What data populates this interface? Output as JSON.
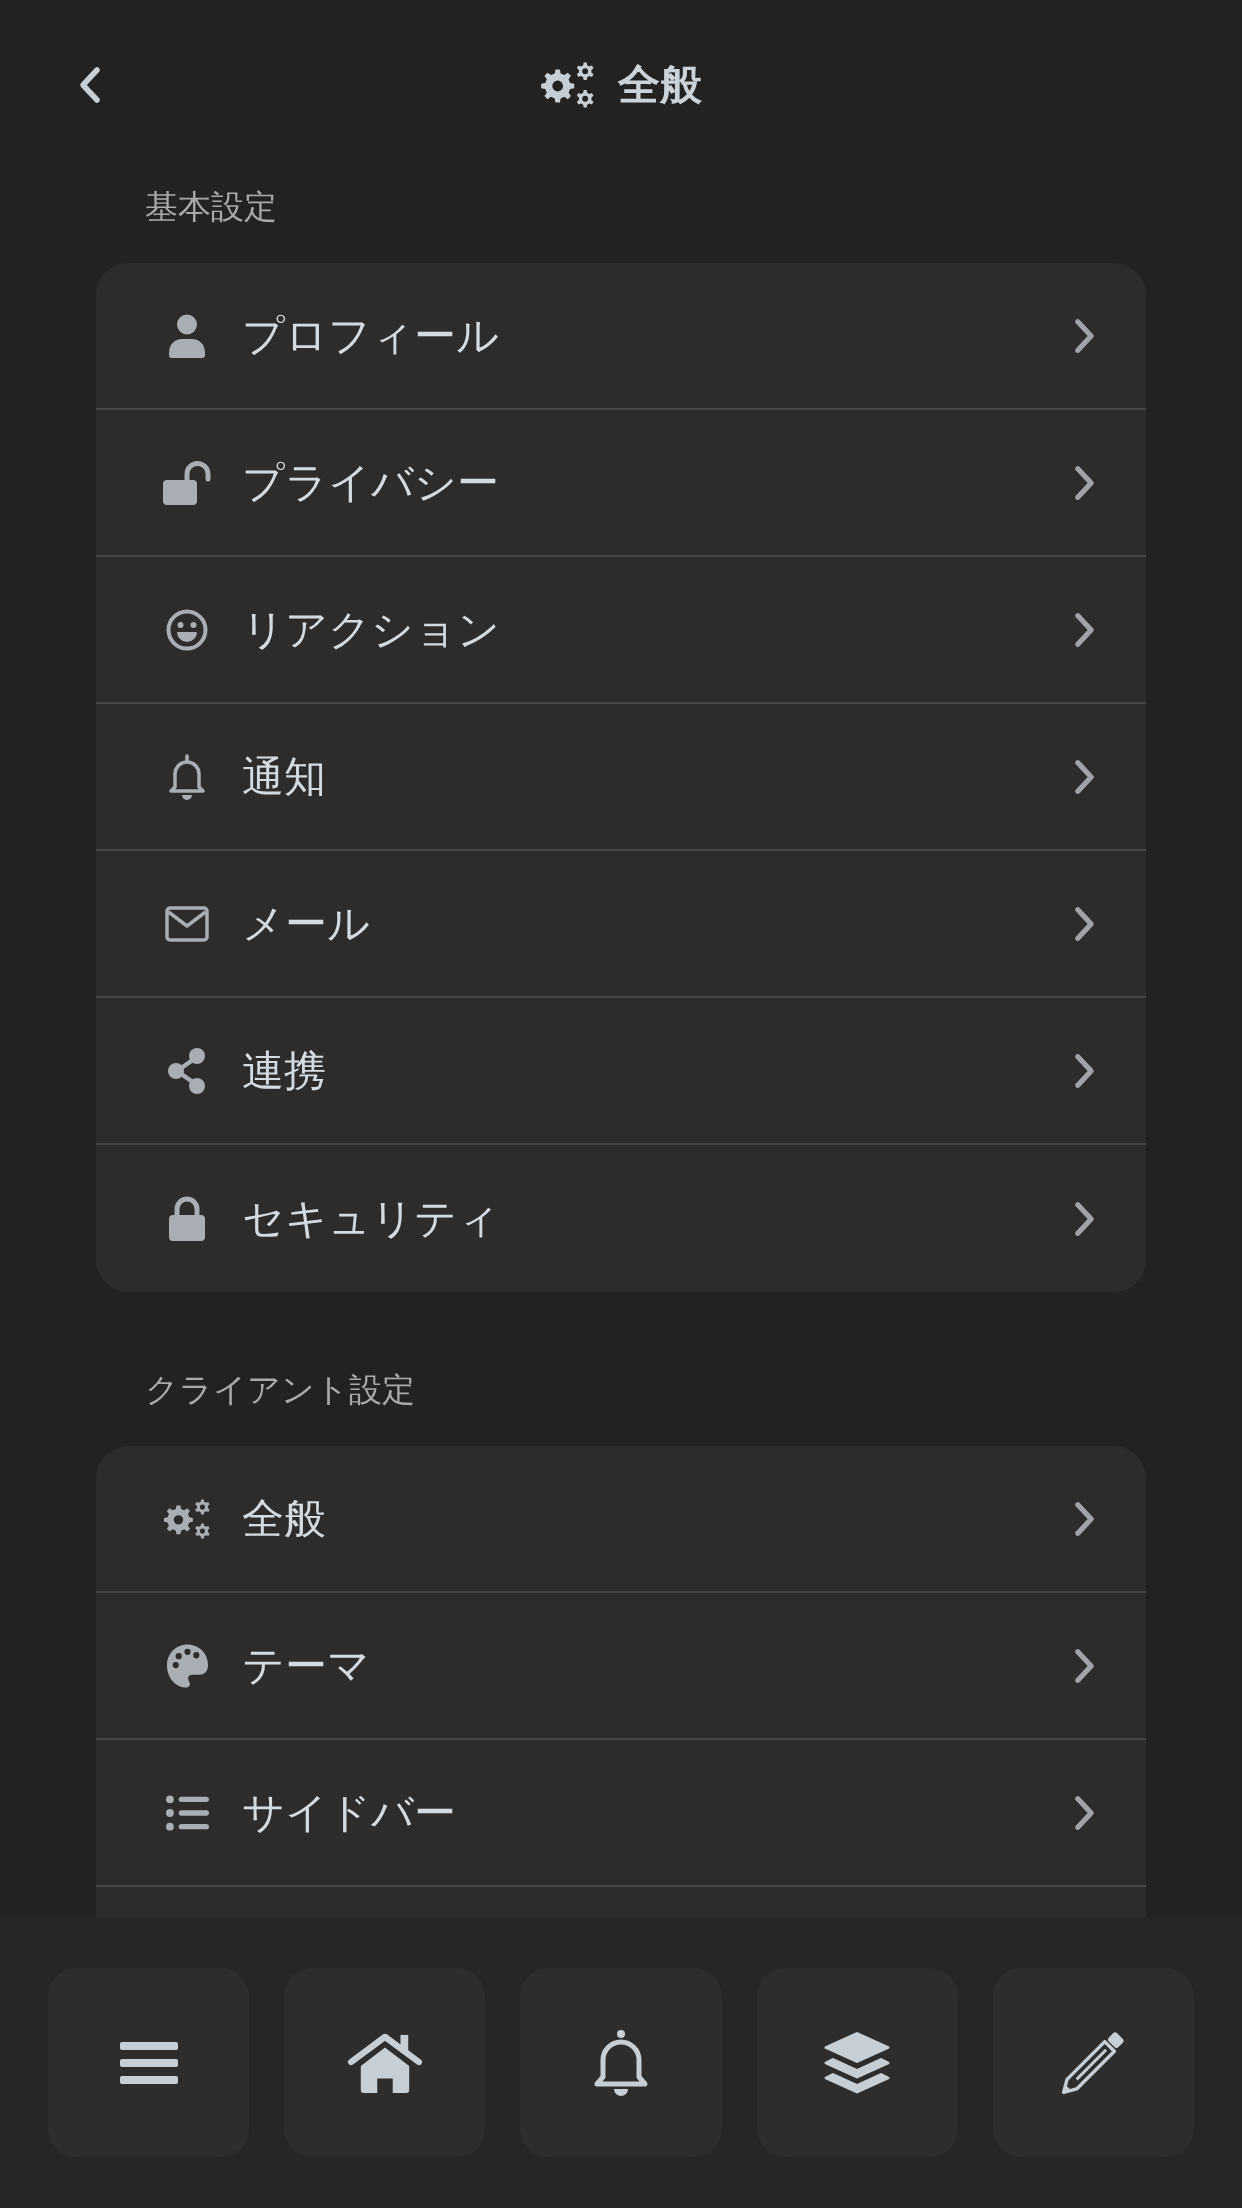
{
  "header": {
    "title": "全般"
  },
  "sections": [
    {
      "label": "基本設定",
      "items": [
        {
          "label": "プロフィール"
        },
        {
          "label": "プライバシー"
        },
        {
          "label": "リアクション"
        },
        {
          "label": "通知"
        },
        {
          "label": "メール"
        },
        {
          "label": "連携"
        },
        {
          "label": "セキュリティ"
        }
      ]
    },
    {
      "label": "クライアント設定",
      "items": [
        {
          "label": "全般"
        },
        {
          "label": "テーマ"
        },
        {
          "label": "サイドバー"
        }
      ]
    }
  ]
}
